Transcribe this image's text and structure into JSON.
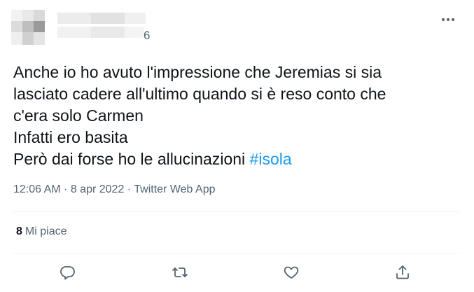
{
  "author": {
    "handle_visible_suffix": "6"
  },
  "tweet": {
    "lines": [
      "Anche io ho avuto l'impressione che Jeremias si sia",
      "lasciato cadere all'ultimo quando si è reso conto che",
      "c'era solo Carmen",
      "Infatti ero basita"
    ],
    "last_line_prefix": "Però dai forse ho le allucinazioni ",
    "hashtag": "#isola"
  },
  "meta": {
    "time": "12:06 AM",
    "separator": " · ",
    "date": "8 apr 2022",
    "source": "Twitter Web App"
  },
  "engagement": {
    "likes_count": "8",
    "likes_label": "Mi piace"
  },
  "icons": {
    "more": "more-horizontal-icon",
    "reply": "reply-icon",
    "retweet": "retweet-icon",
    "like": "heart-icon",
    "share": "share-icon"
  },
  "colors": {
    "text": "#0f1419",
    "secondary": "#536471",
    "hashtag": "#1d9bf0",
    "divider": "#eff3f4"
  }
}
